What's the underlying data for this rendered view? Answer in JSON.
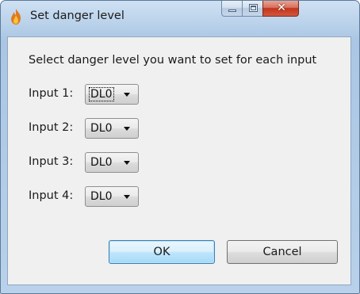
{
  "window": {
    "title": "Set danger level",
    "icon": "flame-icon",
    "controls": {
      "minimize": "minimize-icon",
      "maximize": "maximize-icon",
      "close": "✕"
    }
  },
  "dialog": {
    "instruction": "Select danger level you want to set for each input",
    "rows": [
      {
        "label": "Input 1:",
        "value": "DL0"
      },
      {
        "label": "Input 2:",
        "value": "DL0"
      },
      {
        "label": "Input 3:",
        "value": "DL0"
      },
      {
        "label": "Input 4:",
        "value": "DL0"
      }
    ],
    "ok_label": "OK",
    "cancel_label": "Cancel"
  },
  "colors": {
    "frame": "#b9d1ea",
    "client": "#f0f0f0",
    "close_button": "#c2341c",
    "default_button_border": "#3c7fb1"
  }
}
